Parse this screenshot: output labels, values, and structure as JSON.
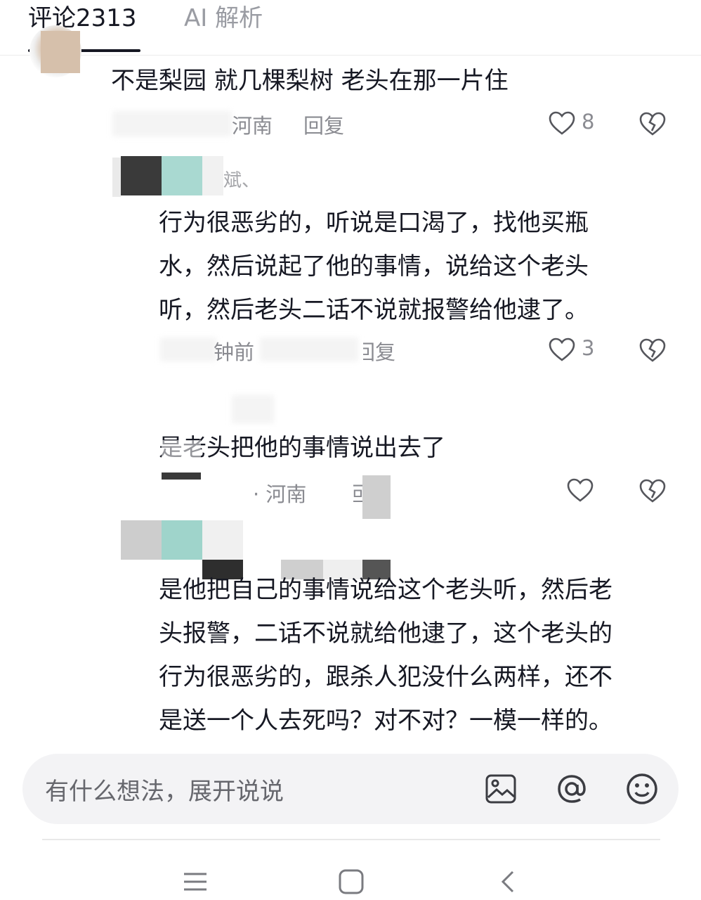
{
  "tabs": [
    {
      "label": "评论2313",
      "active": true
    },
    {
      "label": "AI 解析",
      "active": false
    }
  ],
  "comments": [
    {
      "text": "不是梨园  就几棵梨树 老头在那一片住",
      "location": "河南",
      "reply_label": "回复",
      "likes": "8"
    },
    {
      "username": "斌、",
      "lines": [
        "行为很恶劣的，听说是口渴了，找他买瓶",
        "水，然后说起了他的事情，说给这个老头",
        "听，然后老头二话不说就报警给他逮了。"
      ],
      "time": "钟前",
      "reply_label": "回复",
      "likes": "3"
    },
    {
      "text": "是老头把他的事情说出去了",
      "location": "· 河南",
      "reply_label": "回复",
      "likes": ""
    },
    {
      "lines": [
        "是他把自己的事情说给这个老头听，然后老",
        "头报警，二话不说就给他逮了，这个老头的",
        "行为很恶劣的，跟杀人犯没什么两样，还不",
        "是送一个人去死吗？对不对？一模一样的。"
      ]
    }
  ],
  "input": {
    "placeholder": "有什么想法，展开说说"
  },
  "icons": [
    "heart-icon",
    "dislike-icon",
    "image-icon",
    "at-icon",
    "emoji-icon",
    "menu-icon",
    "home-icon",
    "back-icon"
  ],
  "colors": {
    "text": "#161823",
    "muted": "#8a8b91",
    "bar": "#f3f3f5"
  }
}
